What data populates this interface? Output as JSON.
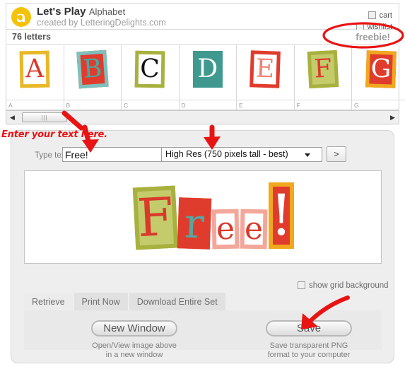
{
  "header": {
    "logo_icon": "letteringdelights-a-logo-icon",
    "title_bold": "Let's Play",
    "title_light": "Alphabet",
    "subtitle": "created by LetteringDelights.com",
    "cart_label": "cart",
    "wishlist_label": "wishlist",
    "cart_checked": false,
    "wishlist_checked": false
  },
  "countbar": {
    "letters_count": "76 letters",
    "freebie_label": "freebie!"
  },
  "tiles": [
    {
      "letter": "A",
      "label": "A",
      "bg": "#ffffff",
      "border": "#e8b828",
      "fg": "#d93a2b",
      "rot": -1
    },
    {
      "letter": "B",
      "label": "B",
      "bg": "#e03c2e",
      "border": "#7ec0bb",
      "fg": "#4aa79f",
      "rot": -4
    },
    {
      "letter": "C",
      "label": "C",
      "bg": "#ffffff",
      "border": "#a8b13f",
      "fg": "#111111",
      "rot": 1
    },
    {
      "letter": "D",
      "label": "D",
      "bg": "#40998f",
      "border": "#40998f",
      "fg": "#ffffff",
      "rot": 0
    },
    {
      "letter": "E",
      "label": "E",
      "bg": "#ffffff",
      "border": "#e03c2e",
      "fg": "#ef8372",
      "rot": 2
    },
    {
      "letter": "F",
      "label": "F",
      "bg": "#c3cb6b",
      "border": "#a8b13f",
      "fg": "#d93a2b",
      "rot": -3
    },
    {
      "letter": "G",
      "label": "G",
      "bg": "#e03c2e",
      "border": "#f0a81e",
      "fg": "#ffffff",
      "rot": 2
    }
  ],
  "scrollbar": {
    "left_arrow_icon": "triangle-left-icon",
    "right_arrow_icon": "triangle-right-icon",
    "thumb_grip_icon": "grip-lines-icon",
    "thumb_grip": "|||"
  },
  "form": {
    "type_text_label": "Type text",
    "text_value": "Free!",
    "text_placeholder": "",
    "resolution_selected": "High Res (750 pixels tall - best)",
    "resolution_options": [
      "High Res (750 pixels tall - best)"
    ],
    "go_button": ">",
    "dropdown_icon": "chevron-down-icon"
  },
  "preview": {
    "word": "Free!",
    "letters": [
      {
        "ch": "F",
        "bg": "#c3cb6b",
        "border": "#a8b13f",
        "fg": "#d93a2b",
        "w": 60,
        "h": 88,
        "rot": -3,
        "fs": 74
      },
      {
        "ch": "r",
        "bg": "#e03c2e",
        "border": "#e03c2e",
        "fg": "#55a79f",
        "w": 46,
        "h": 72,
        "rot": 2,
        "fs": 58
      },
      {
        "ch": "e",
        "bg": "#ffffff",
        "border": "#f3a79a",
        "fg": "#d93a2b",
        "w": 38,
        "h": 56,
        "rot": -1,
        "fs": 44
      },
      {
        "ch": "e",
        "bg": "#ffffff",
        "border": "#f3a79a",
        "fg": "#d93a2b",
        "w": 38,
        "h": 56,
        "rot": 1,
        "fs": 44
      },
      {
        "ch": "!",
        "bg": "#e03c2e",
        "border": "#f0a81e",
        "fg": "#ffffff",
        "w": 36,
        "h": 94,
        "rot": 0,
        "fs": 80
      }
    ]
  },
  "grid_option": {
    "label": "show grid background",
    "checked": false
  },
  "tabs": [
    {
      "label": "Retrieve",
      "active": true
    },
    {
      "label": "Print Now",
      "active": false
    },
    {
      "label": "Download Entire Set",
      "active": false
    }
  ],
  "actions": {
    "new_window_label": "New Window",
    "new_window_caption": "Open/View image above\nin a new window",
    "save_label": "Save",
    "save_caption": "Save transparent PNG\nformat to your computer"
  },
  "annotations": {
    "enter_text_note": "Enter your text here.",
    "color": "#ee1111",
    "arrow_input_icon": "red-arrow-down-icon",
    "arrow_resolution_icon": "red-arrow-down-icon",
    "arrow_save_icon": "red-arrow-curved-icon",
    "arrow_scroll_icon": "red-arrow-stroke-icon",
    "ellipse_freebie_icon": "red-ellipse-icon"
  }
}
